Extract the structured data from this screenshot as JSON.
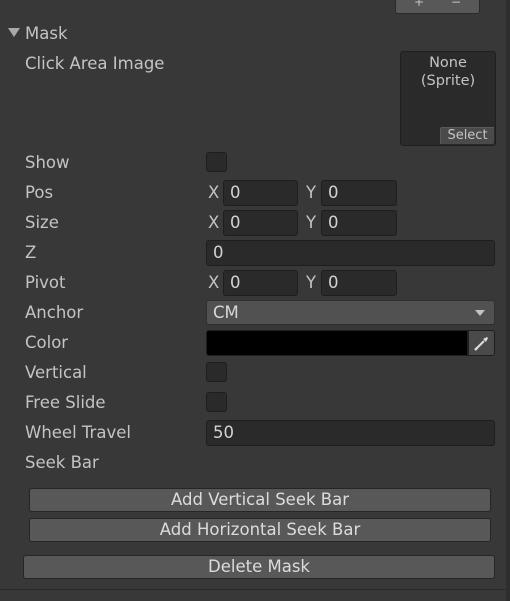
{
  "section": {
    "title": "Mask"
  },
  "click_area": {
    "label": "Click Area Image",
    "sprite_value": "None",
    "sprite_type": "(Sprite)",
    "select_label": "Select"
  },
  "fields": {
    "show_label": "Show",
    "pos_label": "Pos",
    "pos_x": "0",
    "pos_y": "0",
    "size_label": "Size",
    "size_x": "0",
    "size_y": "0",
    "z_label": "Z",
    "z_value": "0",
    "pivot_label": "Pivot",
    "pivot_x": "0",
    "pivot_y": "0",
    "anchor_label": "Anchor",
    "anchor_value": "CM",
    "color_label": "Color",
    "color_value": "#000000",
    "vertical_label": "Vertical",
    "free_slide_label": "Free Slide",
    "wheel_travel_label": "Wheel Travel",
    "wheel_travel_value": "50",
    "seek_bar_label": "Seek Bar",
    "x_axis": "X",
    "y_axis": "Y"
  },
  "buttons": {
    "add_vertical": "Add Vertical Seek Bar",
    "add_horizontal": "Add Horizontal Seek Bar",
    "delete_mask": "Delete Mask"
  },
  "toolbar": {
    "plus_glyph": "+",
    "minus_glyph": "−"
  }
}
